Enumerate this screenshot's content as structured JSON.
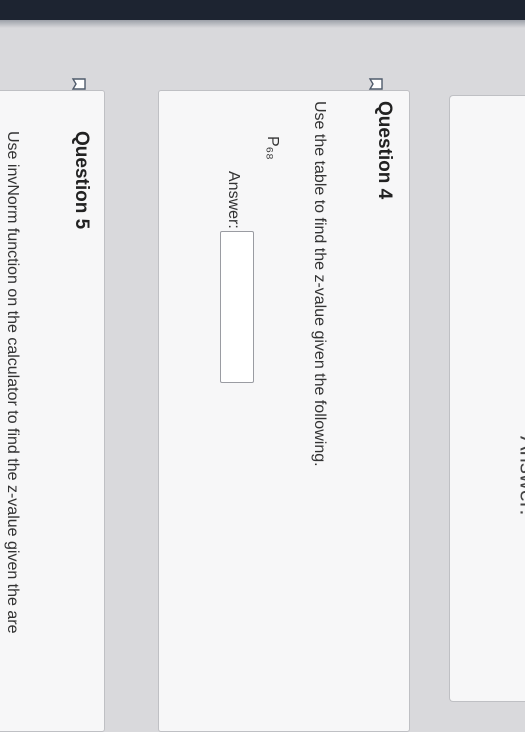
{
  "previous_question": {
    "answer_label": "Answer:"
  },
  "question4": {
    "title": "Question 4",
    "prompt": "Use the table to find the z-value given the following.",
    "item_label": "P₆₈",
    "answer_label": "Answer:",
    "answer_value": ""
  },
  "question5": {
    "title": "Question 5",
    "prompt": "Use invNorm function on the calculator to find the z-value given the are"
  }
}
